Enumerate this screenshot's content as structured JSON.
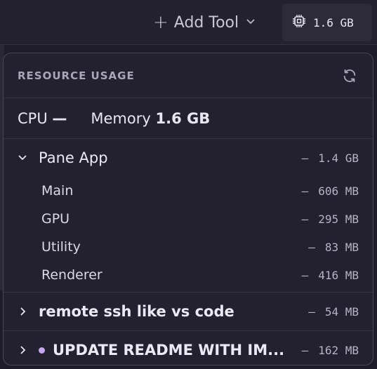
{
  "toolbar": {
    "add_tool_label": "Add Tool",
    "memory_button_value": "1.6 GB"
  },
  "panel": {
    "title": "RESOURCE USAGE",
    "summary": {
      "cpu_label": "CPU",
      "cpu_value": "—",
      "memory_label": "Memory",
      "memory_value": "1.6 GB"
    },
    "groups": [
      {
        "name": "Pane App",
        "expanded": true,
        "dash": "–",
        "size": "1.4 GB",
        "children": [
          {
            "name": "Main",
            "dash": "–",
            "size": "606 MB"
          },
          {
            "name": "GPU",
            "dash": "–",
            "size": "295 MB"
          },
          {
            "name": "Utility",
            "dash": "–",
            "size": "83 MB"
          },
          {
            "name": "Renderer",
            "dash": "–",
            "size": "416 MB"
          }
        ]
      },
      {
        "name": "remote ssh like vs code",
        "expanded": false,
        "dash": "–",
        "size": "54 MB"
      },
      {
        "name": "UPDATE README WITH IM...",
        "expanded": false,
        "dash": "–",
        "size": "162 MB",
        "has_dot": true
      }
    ]
  },
  "colors": {
    "accent_dot": "#c7a6f0",
    "panel_bg": "#232130",
    "border": "#4a4758"
  }
}
